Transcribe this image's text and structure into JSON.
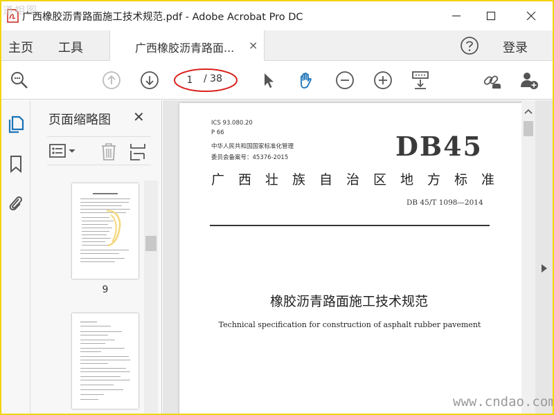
{
  "window": {
    "title": "广西橡胶沥青路面施工技术规范.pdf - Adobe Acrobat Pro DC",
    "watermark_top_left": "道相图"
  },
  "menu": {
    "home_label": "主页",
    "tools_label": "工具",
    "doc_tab_label": "广西橡胶沥青路面...",
    "doc_tab_close": "×",
    "login_label": "登录"
  },
  "toolbar": {
    "current_page": "1",
    "total_pages": "/ 38",
    "icons": [
      "search-zoom-icon",
      "prev-page-icon",
      "next-page-icon",
      "select-cursor-icon",
      "hand-tool-icon",
      "zoom-out-icon",
      "zoom-in-icon",
      "scroll-mode-icon",
      "share-link-icon",
      "add-user-icon"
    ],
    "accent_color": "#1a73b8",
    "annotation_color": "#d9201c"
  },
  "left_rail": {
    "icons": [
      "page-thumbnails-icon",
      "bookmark-icon",
      "attachment-icon"
    ]
  },
  "thumbnails_panel": {
    "title": "页面缩略图",
    "close": "✕",
    "visible_page_label": "9"
  },
  "document": {
    "meta_lines": [
      "ICS 93.080.20",
      "P 66",
      "中华人民共和国国家标准化管理",
      "委员会备案号：45376-2015"
    ],
    "logo": "DB45",
    "standard_title": "广西壮族自治区地方标准",
    "standard_number": "DB 45/T 1098—2014",
    "chinese_title": "橡胶沥青路面施工技术规范",
    "english_title": "Technical specification for construction of asphalt rubber pavement"
  },
  "watermark_bottom_right": "www.cndao.com"
}
